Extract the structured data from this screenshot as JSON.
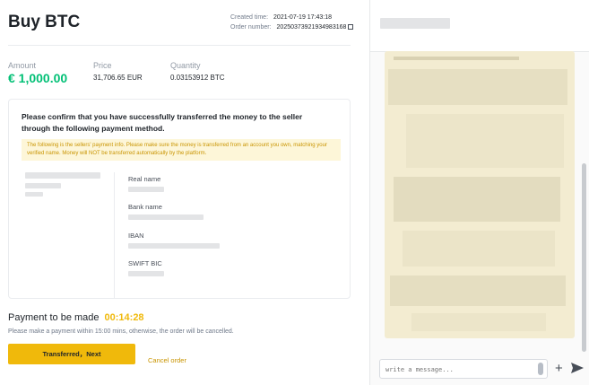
{
  "order": {
    "title": "Buy BTC",
    "created_label": "Created time:",
    "created_value": "2021-07-19 17:43:18",
    "number_label": "Order number:",
    "number_value": "20250373921934983168"
  },
  "stats": {
    "amount_label": "Amount",
    "amount_value": "€ 1,000.00",
    "price_label": "Price",
    "price_value": "31,706.65 EUR",
    "quantity_label": "Quantity",
    "quantity_value": "0.03153912 BTC"
  },
  "payment_card": {
    "heading": "Please confirm that you have successfully transferred the money to the seller through the following payment method.",
    "notice": "The following is the sellers' payment info. Please make sure the money is transferred from an account you own, matching your verified name. Money will NOT be transferred automatically by the platform.",
    "fields": {
      "real_name": "Real name",
      "bank_name": "Bank name",
      "iban": "IBAN",
      "swift": "SWIFT BIC"
    }
  },
  "payment": {
    "title": "Payment to be made",
    "timer": "00:14:28",
    "note": "Please make a payment within 15:00 mins, otherwise, the order will be cancelled.",
    "primary_button": "Transferred，Next",
    "cancel_link": "Cancel order"
  },
  "chat": {
    "placeholder": "write a message..."
  },
  "colors": {
    "accent": "#f0b90b",
    "amount": "#02c076",
    "notice_bg": "#fdf6d8"
  }
}
